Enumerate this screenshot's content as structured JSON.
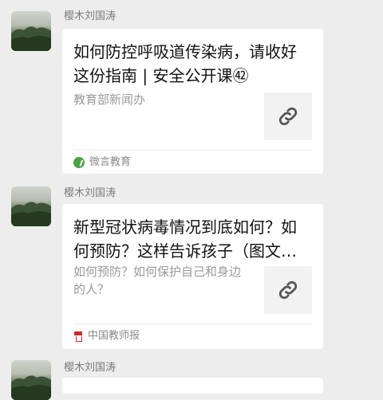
{
  "messages": [
    {
      "sender": "樱木刘国涛",
      "title": "如何防控呼吸道传染病，请收好这份指南 | 安全公开课㊷",
      "desc": "教育部新闻办",
      "source": "微言教育",
      "source_icon": "wechat-green-leaf-icon",
      "link_icon": "link-icon"
    },
    {
      "sender": "樱木刘国涛",
      "title": "新型冠状病毒情况到底如何？如何预防？这样告诉孩子（图文详…",
      "desc": "如何预防？如何保护自己和身边的人？",
      "source": "中国教师报",
      "source_icon": "newspaper-red-icon",
      "link_icon": "link-icon"
    },
    {
      "sender": "樱木刘国涛"
    }
  ],
  "colors": {
    "background": "#ededed",
    "card": "#ffffff",
    "sender_text": "#7b7b7b",
    "title_text": "#111111",
    "desc_text": "#9a9a9a"
  }
}
